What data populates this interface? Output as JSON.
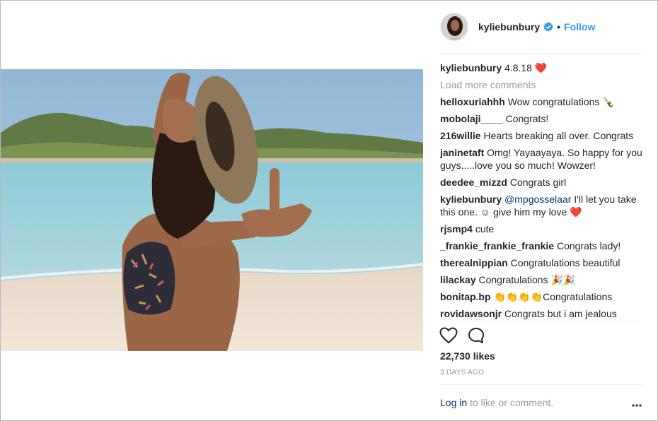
{
  "post": {
    "username": "kylie​bunbury",
    "follow_label": "Follow",
    "dot": "•"
  },
  "caption": {
    "username": "kyliebunbury",
    "text": "4.8.18 ❤️"
  },
  "load_more": "Load more comments",
  "comments": [
    {
      "user": "helloxuriahhh",
      "text": "Wow congratulations 🍾"
    },
    {
      "user": "mobolaji____",
      "text": "Congrats!"
    },
    {
      "user": "216willie",
      "text": "Hearts breaking all over. Congrats"
    },
    {
      "user": "janinetaft",
      "text": "Omg! Yayaayaya. So happy for you guys.....love you so much! Wowzer!"
    },
    {
      "user": "deedee_mizzd",
      "text": "Congrats girl"
    },
    {
      "user": "kyliebunbury",
      "mention": "@mpgosselaar",
      "text": " I'll let you take this one. ☺ give him my love ❤️"
    },
    {
      "user": "rjsmp4",
      "text": "cute"
    },
    {
      "user": "_frankie_frankie_frankie",
      "text": "Congrats lady!"
    },
    {
      "user": "therealnippian",
      "text": "Congratulations beautiful"
    },
    {
      "user": "lilackay",
      "text": "Congratulations 🎉🎉"
    },
    {
      "user": "bonitap.bp",
      "text": "👏👏👏👏Congratulations"
    },
    {
      "user": "rovidawsonjr",
      "text": "Congrats but i am jealous"
    }
  ],
  "likes": "22,730 likes",
  "time_ago": "3 DAYS AGO",
  "login": {
    "link": "Log in",
    "text": " to like or comment."
  },
  "icons": [
    "heart-icon",
    "comment-icon",
    "more-options-icon",
    "verified-badge-icon"
  ],
  "colors": {
    "link_blue": "#3897f0",
    "mention": "#003569",
    "muted": "#999999",
    "sky": "#9ec3dd",
    "sea": "#8cc7d3",
    "sand": "#efe0cf"
  }
}
